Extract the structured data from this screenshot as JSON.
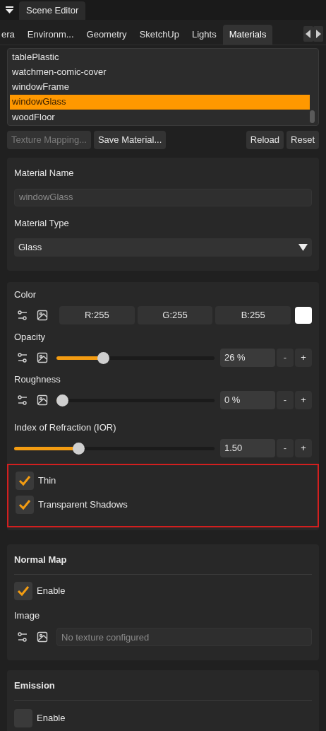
{
  "panel_title": "Scene Editor",
  "tabs": [
    {
      "label": "era",
      "selected": false
    },
    {
      "label": "Environm...",
      "selected": false
    },
    {
      "label": "Geometry",
      "selected": false
    },
    {
      "label": "SketchUp",
      "selected": false
    },
    {
      "label": "Lights",
      "selected": false
    },
    {
      "label": "Materials",
      "selected": true
    }
  ],
  "materials": [
    {
      "name": "tablePlastic",
      "selected": false
    },
    {
      "name": "watchmen-comic-cover",
      "selected": false
    },
    {
      "name": "windowFrame",
      "selected": false
    },
    {
      "name": "windowGlass",
      "selected": true
    },
    {
      "name": "woodFloor",
      "selected": false
    }
  ],
  "actions_left": [
    {
      "label": "Texture Mapping...",
      "disabled": true
    },
    {
      "label": "Save Material...",
      "disabled": false
    }
  ],
  "actions_right": [
    {
      "label": "Reload",
      "disabled": false
    },
    {
      "label": "Reset",
      "disabled": false
    }
  ],
  "material": {
    "name_label": "Material Name",
    "name_value": "windowGlass",
    "type_label": "Material Type",
    "type_value": "Glass"
  },
  "properties": [
    {
      "kind": "color",
      "label": "Color",
      "texture_icons": true,
      "r": "R:255",
      "g": "G:255",
      "b": "B:255",
      "color": "#ffffff"
    },
    {
      "kind": "slider",
      "label": "Opacity",
      "texture_icons": true,
      "level": 0.28,
      "reading": "26 %",
      "minus": "-",
      "plus": "+"
    },
    {
      "kind": "slider",
      "label": "Roughness",
      "texture_icons": true,
      "level": 0,
      "reading": "0 %",
      "minus": "-",
      "plus": "+"
    },
    {
      "kind": "slider",
      "label": "Index of Refraction (IOR)",
      "texture_icons": false,
      "level": 0.31,
      "reading": "1.50",
      "minus": "-",
      "plus": "+"
    }
  ],
  "flags": {
    "highlighted": true,
    "items": [
      {
        "label": "Thin",
        "checked": true
      },
      {
        "label": "Transparent Shadows",
        "checked": true
      }
    ]
  },
  "normal_map": {
    "title": "Normal Map",
    "enable": {
      "label": "Enable",
      "checked": true
    },
    "image_label": "Image",
    "placeholder": "No texture configured"
  },
  "emission": {
    "title": "Emission",
    "enable": {
      "label": "Enable",
      "checked": false
    }
  }
}
